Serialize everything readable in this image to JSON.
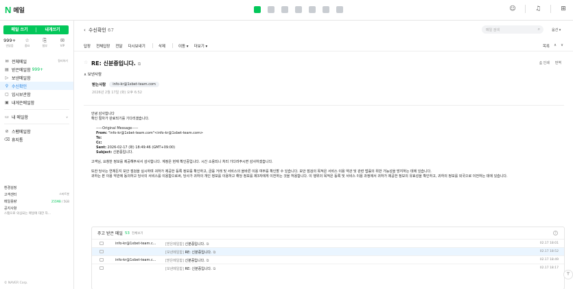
{
  "app": {
    "logo_mark": "N",
    "logo_text": "메일"
  },
  "apps": [
    {
      "icon": "mail-app-icon",
      "active": true
    },
    {
      "icon": "calendar-app-icon",
      "active": false
    },
    {
      "icon": "contacts-app-icon",
      "active": false
    },
    {
      "icon": "drive-app-icon",
      "active": false
    },
    {
      "icon": "memo-app-icon",
      "active": false
    },
    {
      "icon": "office-app-icon",
      "active": false
    },
    {
      "icon": "more-app-icon",
      "active": false
    }
  ],
  "top_right_icons": [
    "chat-icon",
    "bell-icon",
    "grid-icon"
  ],
  "sidebar": {
    "write_label": "메일 쓰기",
    "self_write_label": "내게쓰기",
    "quick": [
      {
        "top": "999+",
        "label": "안읽음"
      },
      {
        "top": "☆",
        "label": "중요"
      },
      {
        "top": "⎘",
        "label": "첨부"
      },
      {
        "top": "✉",
        "label": "VIP"
      }
    ],
    "items": [
      {
        "icon": "✉",
        "label": "전체메일",
        "right": "정리하기"
      },
      {
        "icon": "▤",
        "label": "받은메일함",
        "count": "999+"
      },
      {
        "icon": "▷",
        "label": "보낸메일함"
      },
      {
        "icon": "⚲",
        "label": "수신확인",
        "active": true
      },
      {
        "icon": "▢",
        "label": "임시보관함"
      },
      {
        "icon": "▣",
        "label": "내게쓴메일함"
      }
    ],
    "my_mailbox": "내 메일함",
    "spam": "스팸메일함",
    "trash": "휴지통",
    "env_title": "환경설정",
    "customer_center": "고객센터",
    "customer_right": "스마트봇",
    "capacity_label": "메일용량",
    "capacity_used": "255MB",
    "capacity_total": " / 5GB",
    "notice_title": "공지사항",
    "notice_text": "스팸으로 의심되는 메일에 대한 자...",
    "footer": "© NAVER Corp."
  },
  "header": {
    "back_label": "수신확인",
    "back_count": "67",
    "search_placeholder": "메일 검색",
    "search_option": "옵션 ▾"
  },
  "toolbar": {
    "reply": "답장",
    "reply_all": "전체답장",
    "forward": "전달",
    "resend": "다시보내기",
    "delete": "삭제",
    "move": "이동 ▾",
    "more": "더보기 ▾",
    "list": "목록",
    "up": "∧",
    "down": "∨"
  },
  "message": {
    "subject": "RE: 신분증입니다.",
    "print": "인쇄",
    "translate": "번역",
    "sender_toggle": "보낸사람",
    "from_label": "받는사람",
    "from_address": "info-kr@1xbet-team.com",
    "date": "2026년 2월 17일 (화) 오후 6:52",
    "body_lines": [
      "안녕 감사합니다",
      "확인 절차가 완료되기를 기다리겠습니다."
    ],
    "orig_header": "-----Original Message-----",
    "orig_from_k": "From:",
    "orig_from_v": " \"info-kr@1xbet-team.com\"<info-kr@1xbet-team.com>",
    "orig_to_k": "To:",
    "orig_cc_k": "Cc:",
    "orig_sent_k": "Sent:",
    "orig_sent_v": " 2026-02-17 (화) 18:49:46 (GMT+09:00)",
    "orig_subject_k": "Subject:",
    "orig_subject_v": " 신분증입니다.",
    "para1": "고객님, 요청한 정보를 제공해주셔서 감사합니다. 계정은 현재 확인중입니다. 시간 소용되니 처리 기다려주시면 감사하겠습니다.",
    "para2": "또한 당사는 연체든지 보안 점검을 실시하며 귀하가 제공한 등록 정보를 확인하고, 금융 거래 및 서비스의 올바른 이용 여부를 확인할 수 있습니다. 보안 점검의 목적은 서비스 이용 약관 및 관련 법률의 위반 가능성을 방지하는 데에 있습니다.",
    "para3": "귀하는 본 이용 약관에 동의하고 당사의 서비스를 이용함으로써, 당사가 귀하의 개인 정보를 이용하고 해당 정보를 제3자에게 이전하는 것을 허용합니다. 이 행위의 목적은 등록 및 서비스 이용 과정에서 귀하가 제공한 정보의 유효성을 확인하고, 귀하의 정보를 외국으로 이전하는 데에 있습니다."
  },
  "related": {
    "title": "주고 받은 메일",
    "count": "53",
    "all": "전체보기",
    "help": "?",
    "rows": [
      {
        "from": "info-kr@1xbet-team.c...",
        "folder": "[받은메일함]",
        "subject": "신분증입니다.",
        "time": "02.17 18:01",
        "selected": false,
        "redacted": false
      },
      {
        "from": "",
        "folder": "[보낸메일함]",
        "subject": "RE: 신분증입니다.",
        "time": "02.17 18:52",
        "selected": true,
        "redacted": true
      },
      {
        "from": "info-kr@1xbet-team.c...",
        "folder": "[받은메일함]",
        "subject": "신분증입니다.",
        "time": "02.17 18:49",
        "selected": false,
        "redacted": false
      },
      {
        "from": "",
        "folder": "[보낸메일함]",
        "subject": "RE: 신분증입니다.",
        "time": "02.17 18:17",
        "selected": false,
        "redacted": true
      }
    ]
  },
  "colors": {
    "brand": "#03c75a",
    "selected_bg": "#eaf5ff",
    "link": "#1a7ee3"
  }
}
